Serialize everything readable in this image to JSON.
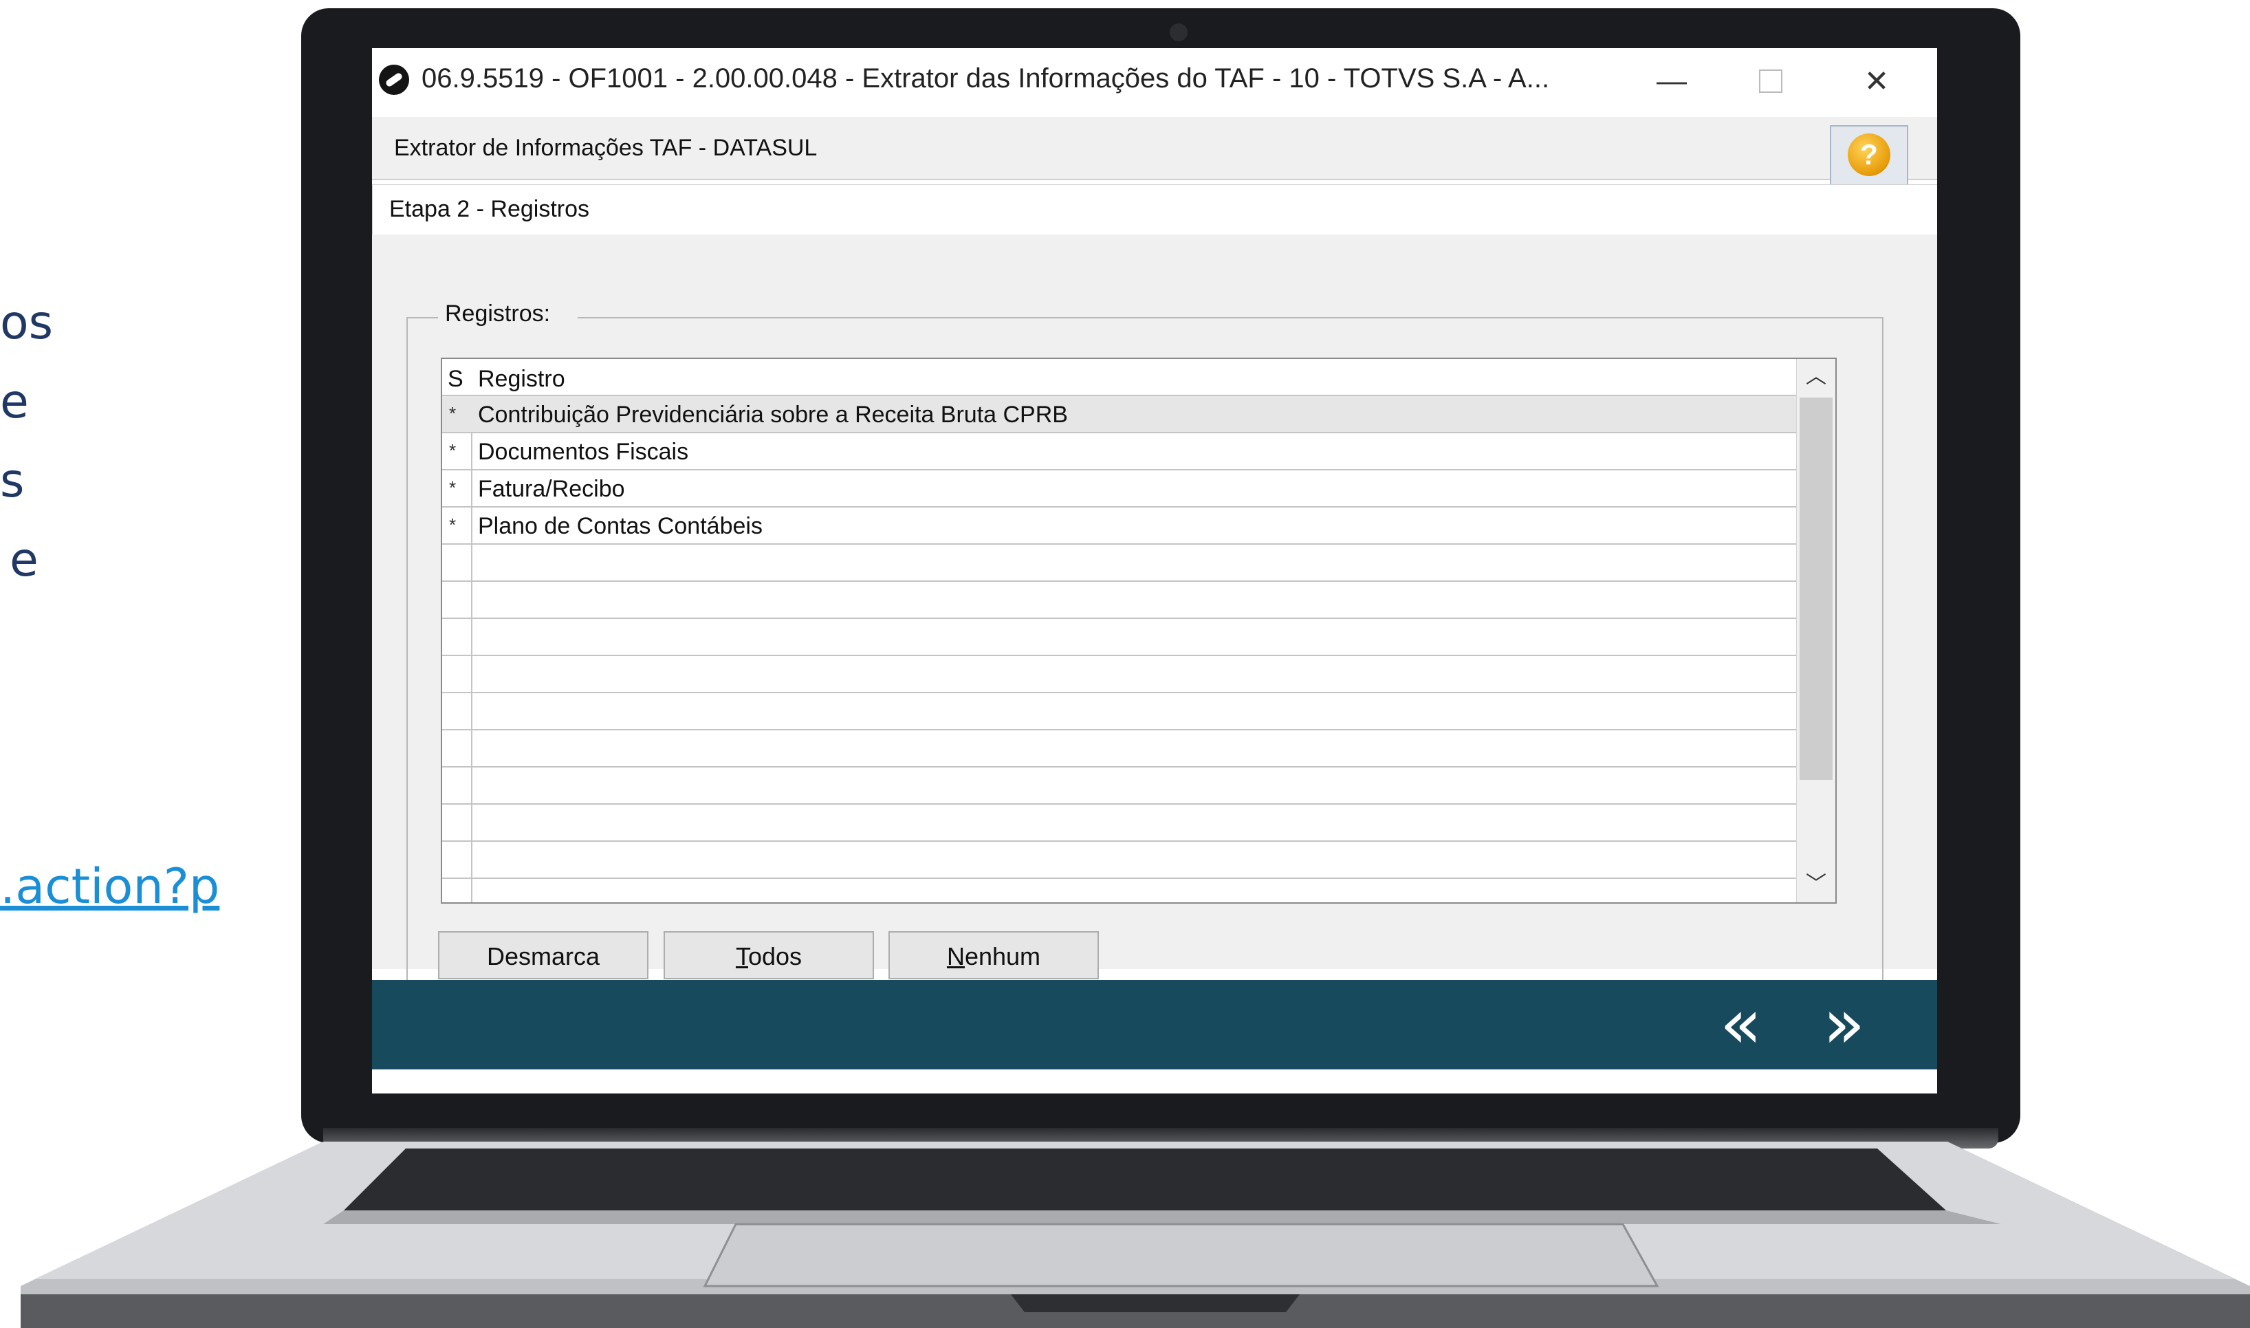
{
  "background": {
    "fragments": [
      "os",
      "e",
      "s",
      "e"
    ],
    "link_fragment": ".action?p"
  },
  "window": {
    "title": "06.9.5519 - OF1001 - 2.00.00.048 - Extrator das Informações do TAF - 10 - TOTVS S.A - A...",
    "controls": {
      "minimize_icon": "minimize-icon",
      "maximize_icon": "maximize-icon",
      "close_icon": "close-icon"
    }
  },
  "header": {
    "title": "Extrator de Informações TAF - DATASUL",
    "help_label": "?"
  },
  "step": {
    "title": "Etapa 2 - Registros"
  },
  "registros": {
    "legend": "Registros:",
    "columns": {
      "s": "S",
      "registro": "Registro"
    },
    "rows": [
      {
        "s": "*",
        "label": "Contribuição Previdenciária sobre a Receita Bruta  CPRB",
        "selected": true
      },
      {
        "s": "*",
        "label": "Documentos Fiscais",
        "selected": false
      },
      {
        "s": "*",
        "label": "Fatura/Recibo",
        "selected": false
      },
      {
        "s": "*",
        "label": "Plano de Contas Contábeis",
        "selected": false
      }
    ],
    "empty_row_count": 10
  },
  "buttons": {
    "desmarca": "Desmarca",
    "todos": "Todos",
    "nenhum": "Nenhum"
  },
  "nav": {
    "back_label": "«",
    "next_label": "»"
  },
  "colors": {
    "nav_bar": "#174a5c",
    "background_text": "#1f3864",
    "link": "#1a8fd6"
  }
}
